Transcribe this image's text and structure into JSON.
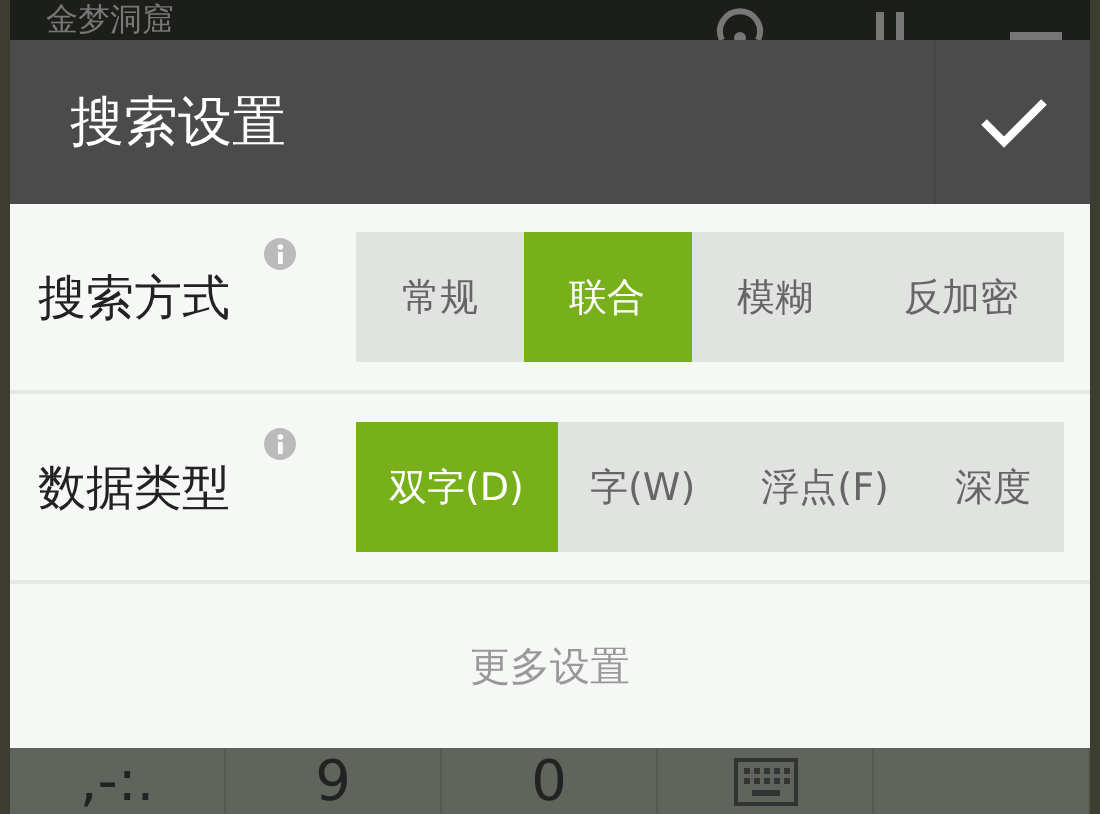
{
  "background_app": {
    "title": "金梦洞窟",
    "keys": [
      ",-:.",
      "9",
      "0"
    ]
  },
  "dialog": {
    "title": "搜索设置",
    "settings": [
      {
        "label": "搜索方式",
        "options": [
          {
            "label": "常规",
            "selected": false
          },
          {
            "label": "联合",
            "selected": true
          },
          {
            "label": "模糊",
            "selected": false
          },
          {
            "label": "反加密",
            "selected": false
          }
        ]
      },
      {
        "label": "数据类型",
        "options": [
          {
            "label": "双字(D)",
            "selected": true
          },
          {
            "label": "字(W)",
            "selected": false
          },
          {
            "label": "浮点(F)",
            "selected": false
          },
          {
            "label": "深度",
            "selected": false
          }
        ]
      }
    ],
    "more_button": "更多设置"
  }
}
